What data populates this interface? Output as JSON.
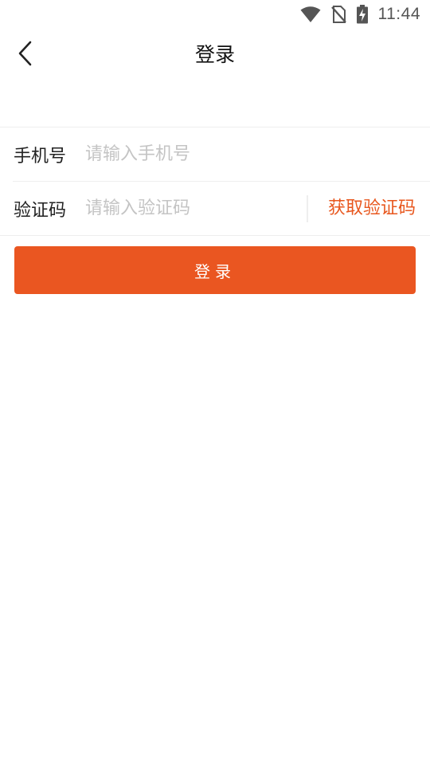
{
  "status_bar": {
    "time": "11:44",
    "icons": [
      "wifi-icon",
      "no-sim-icon",
      "battery-charging-icon"
    ]
  },
  "header": {
    "back_icon": "chevron-left-icon",
    "title": "登录"
  },
  "form": {
    "phone": {
      "label": "手机号",
      "placeholder": "请输入手机号",
      "value": ""
    },
    "code": {
      "label": "验证码",
      "placeholder": "请输入验证码",
      "value": "",
      "get_code_label": "获取验证码"
    }
  },
  "login_button": {
    "label": "登录"
  },
  "colors": {
    "accent": "#ea5621",
    "accent_text": "#e8571e",
    "divider": "#eeeeee",
    "placeholder": "#c4c4c4",
    "text": "#222222"
  }
}
